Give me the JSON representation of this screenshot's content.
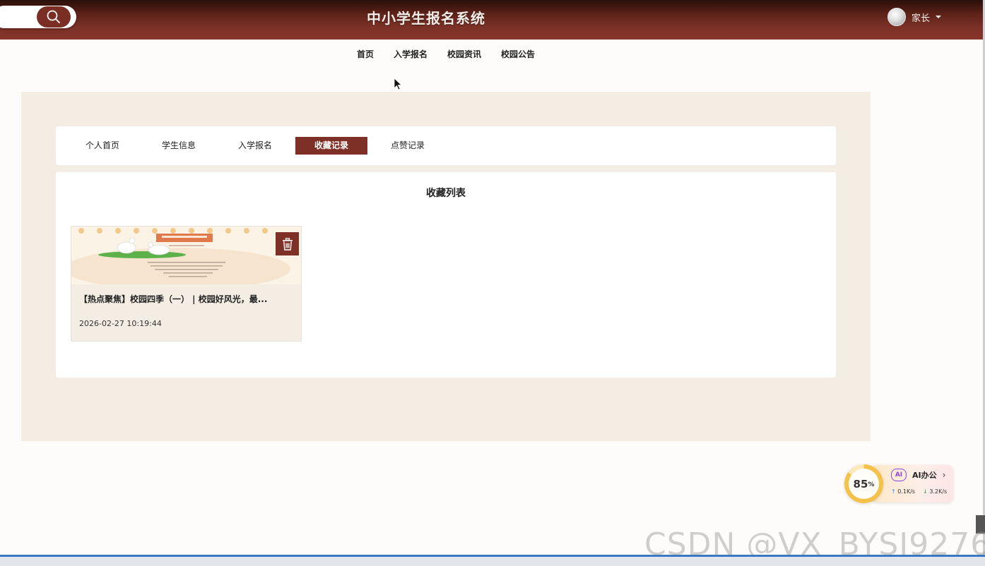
{
  "header": {
    "title": "中小学生报名系统",
    "user_name": "家长"
  },
  "main_nav": [
    "首页",
    "入学报名",
    "校园资讯",
    "校园公告"
  ],
  "tabs": [
    {
      "label": "个人首页",
      "active": false
    },
    {
      "label": "学生信息",
      "active": false
    },
    {
      "label": "入学报名",
      "active": false
    },
    {
      "label": "收藏记录",
      "active": true
    },
    {
      "label": "点赞记录",
      "active": false
    }
  ],
  "favorites": {
    "title": "收藏列表",
    "items": [
      {
        "title": "【热点聚焦】校园四季（一） | 校园好风光，最...",
        "time": "2026-02-27 10:19:44"
      }
    ]
  },
  "widget": {
    "percent": "85",
    "percent_unit": "%",
    "ai_badge": "AI",
    "ai_label": "AI办公",
    "upload_speed": "0.1K/s",
    "download_speed": "3.2K/s"
  },
  "watermark": "CSDN @VX_BYSJ9276",
  "colors": {
    "brand": "#7e3027",
    "panel_bg": "#f4ede4"
  }
}
